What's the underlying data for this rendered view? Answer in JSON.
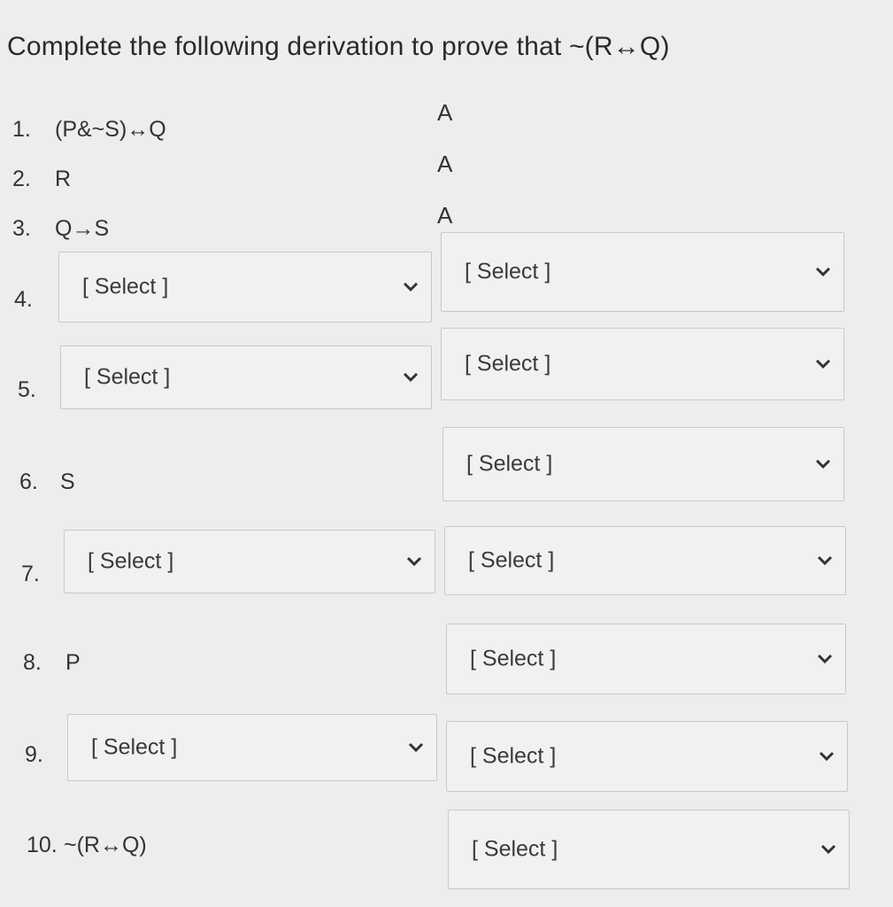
{
  "title": "Complete the following derivation to prove that ~(R↔Q)",
  "lines": [
    {
      "num": "1.",
      "formula": "(P&~S)↔Q",
      "rule": "A"
    },
    {
      "num": "2.",
      "formula": "R",
      "rule": "A"
    },
    {
      "num": "3.",
      "formula": "Q→S",
      "rule": "A"
    },
    {
      "num": "4.",
      "formula_select": "[ Select ]",
      "rule_select": "[ Select ]"
    },
    {
      "num": "5.",
      "formula_select": "[ Select ]",
      "rule_select": "[ Select ]"
    },
    {
      "num": "6.",
      "formula": "S",
      "rule_select": "[ Select ]"
    },
    {
      "num": "7.",
      "formula_select": "[ Select ]",
      "rule_select": "[ Select ]"
    },
    {
      "num": "8.",
      "formula": "P",
      "rule_select": "[ Select ]"
    },
    {
      "num": "9.",
      "formula_select": "[ Select ]",
      "rule_select": "[ Select ]"
    },
    {
      "num": "10.",
      "formula": "~(R↔Q)",
      "rule_select": "[ Select ]"
    }
  ],
  "icons": {
    "dropdown": "chevron-down-icon"
  }
}
